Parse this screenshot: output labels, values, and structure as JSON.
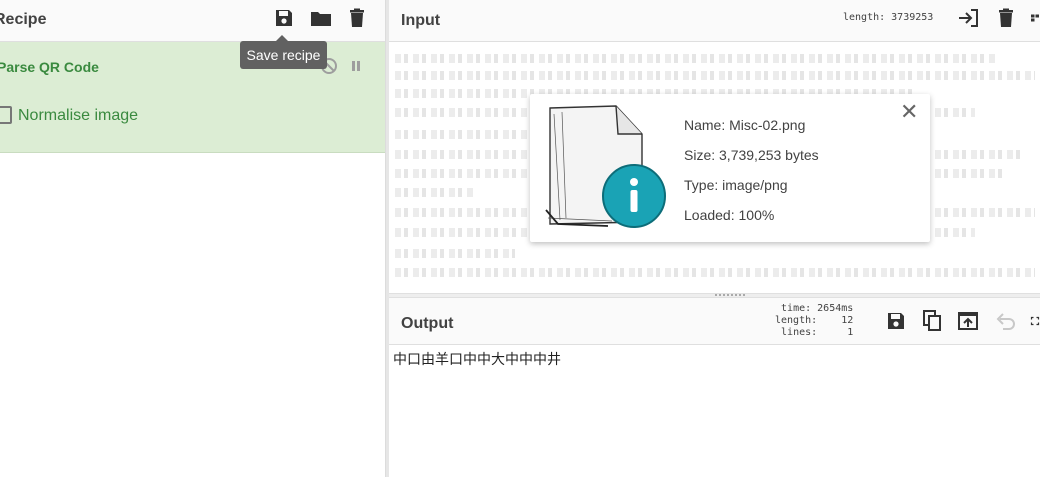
{
  "recipe": {
    "title": "Recipe",
    "save_tooltip": "Save recipe",
    "operation": {
      "name": "Parse QR Code",
      "option_label": "Normalise image",
      "option_checked": false
    }
  },
  "input": {
    "title": "Input",
    "length_label": "length: 3739253"
  },
  "file": {
    "name": "Name: Misc-02.png",
    "size": "Size: 3,739,253 bytes",
    "type": "Type: image/png",
    "loaded": "Loaded: 100%",
    "close_glyph": "✕"
  },
  "output": {
    "title": "Output",
    "stats": {
      "time": "time: 2654ms",
      "length": "length:    12",
      "lines": "lines:     1"
    },
    "text": "中口由羊口中中大中中中井"
  },
  "colors": {
    "operation_bg": "#dcedd4",
    "operation_text": "#3a8a3f",
    "file_icon_teal": "#1aa3b5"
  }
}
